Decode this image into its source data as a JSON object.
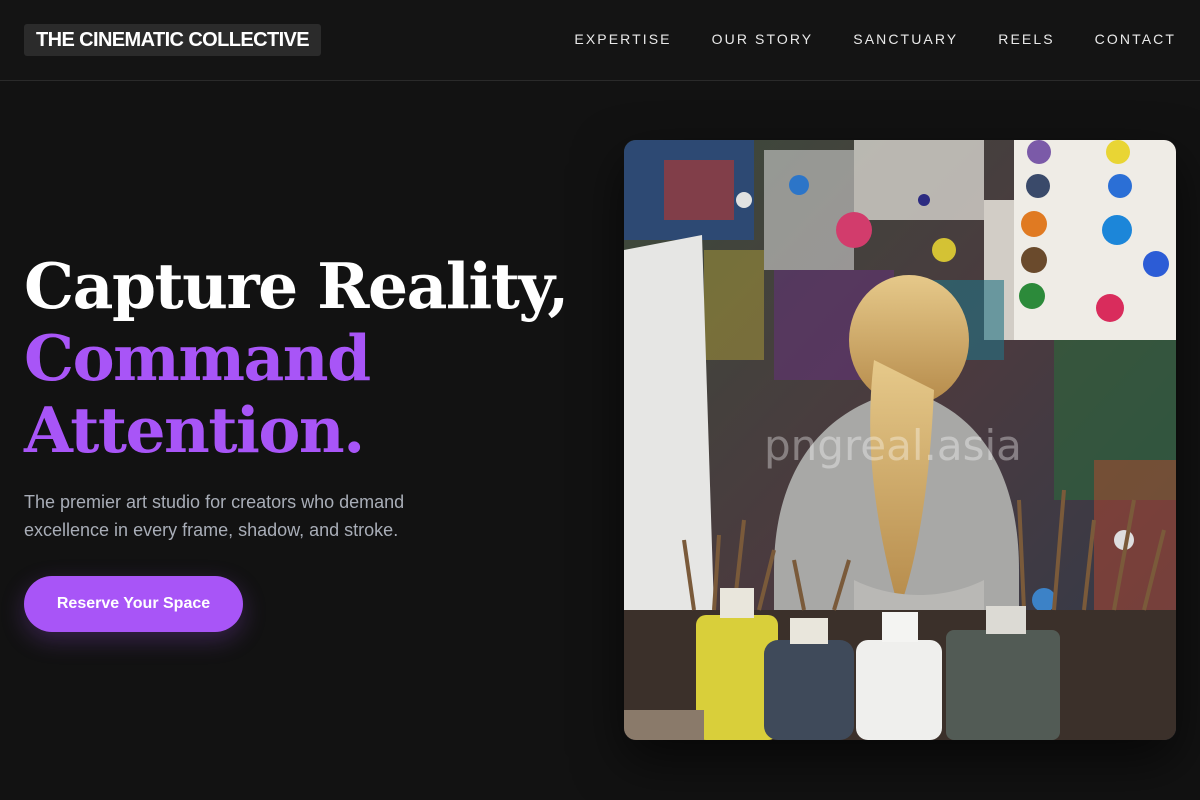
{
  "header": {
    "logo": "THE CINEMATIC COLLECTIVE",
    "nav": [
      {
        "label": "EXPERTISE"
      },
      {
        "label": "OUR STORY"
      },
      {
        "label": "SANCTUARY"
      },
      {
        "label": "REELS"
      },
      {
        "label": "CONTACT"
      }
    ]
  },
  "hero": {
    "title_line1": "Capture Reality,",
    "title_line2": "Command",
    "title_line3": "Attention.",
    "tagline": "The premier art studio for creators who demand excellence in every frame, shadow, and stroke.",
    "cta_label": "Reserve Your Space",
    "image_watermark": "pngreal.asia",
    "image_alt": "Child painting in an art studio with paint-splattered walls and jars of brushes"
  },
  "colors": {
    "background": "#121212",
    "accent": "#a855f7",
    "text": "#ffffff",
    "muted_text": "#a8adb7"
  }
}
